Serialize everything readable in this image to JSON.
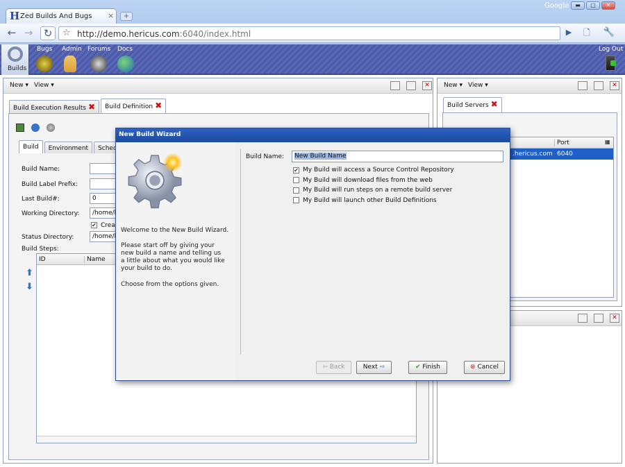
{
  "browser": {
    "tab_title": "Zed Builds And Bugs",
    "tab_close": "×",
    "new_tab": "+",
    "brand": "Google",
    "url_host": "http://demo.hericus.com",
    "url_rest": ":6040/index.html"
  },
  "app": {
    "nav": [
      {
        "label": "Builds",
        "icon": "magnifier-icon"
      },
      {
        "label": "Bugs",
        "icon": "bug-icon"
      },
      {
        "label": "Admin",
        "icon": "admin-user-icon"
      },
      {
        "label": "Forums",
        "icon": "speaker-icon"
      },
      {
        "label": "Docs",
        "icon": "globe-icon"
      }
    ],
    "logout": "Log Out"
  },
  "left_panel": {
    "menu_new": "New",
    "menu_view": "View",
    "tabs": [
      "Build Execution Results",
      "Build Definition"
    ],
    "subtabs": [
      "Build",
      "Environment",
      "Schedule"
    ],
    "fields": {
      "build_name_label": "Build Name:",
      "build_label_prefix_label": "Build Label Prefix:",
      "last_build_label": "Last Build#:",
      "last_build_value": "0",
      "working_dir_label": "Working Directory:",
      "working_dir_value": "/home/b",
      "create_label": "Creat",
      "status_dir_label": "Status Directory:",
      "status_dir_value": "/home/b",
      "build_steps_label": "Build Steps:"
    },
    "steps_columns": [
      "ID",
      "Name"
    ]
  },
  "right_panel": {
    "menu_new": "New",
    "menu_view": "View",
    "tab": "Build Servers",
    "columns": [
      "",
      "Port"
    ],
    "rows": [
      {
        "host": ".hericus.com",
        "port": "6040"
      }
    ]
  },
  "dialog": {
    "title": "New Build Wizard",
    "welcome": "Welcome to the New Build Wizard.",
    "para1": "Please start off by giving your new build a name and telling us a little about what you would like your build to do.",
    "para2": "Choose from the options given.",
    "build_name_label": "Build Name:",
    "build_name_value": "New Build Name",
    "options": [
      {
        "label": "My Build will access a Source Control Repository",
        "checked": true
      },
      {
        "label": "My Build will download files from the web",
        "checked": false
      },
      {
        "label": "My Build will run steps on a remote build server",
        "checked": false
      },
      {
        "label": "My Build will launch other Build Definitions",
        "checked": false
      }
    ],
    "buttons": {
      "back": "Back",
      "next": "Next",
      "finish": "Finish",
      "cancel": "Cancel"
    }
  }
}
